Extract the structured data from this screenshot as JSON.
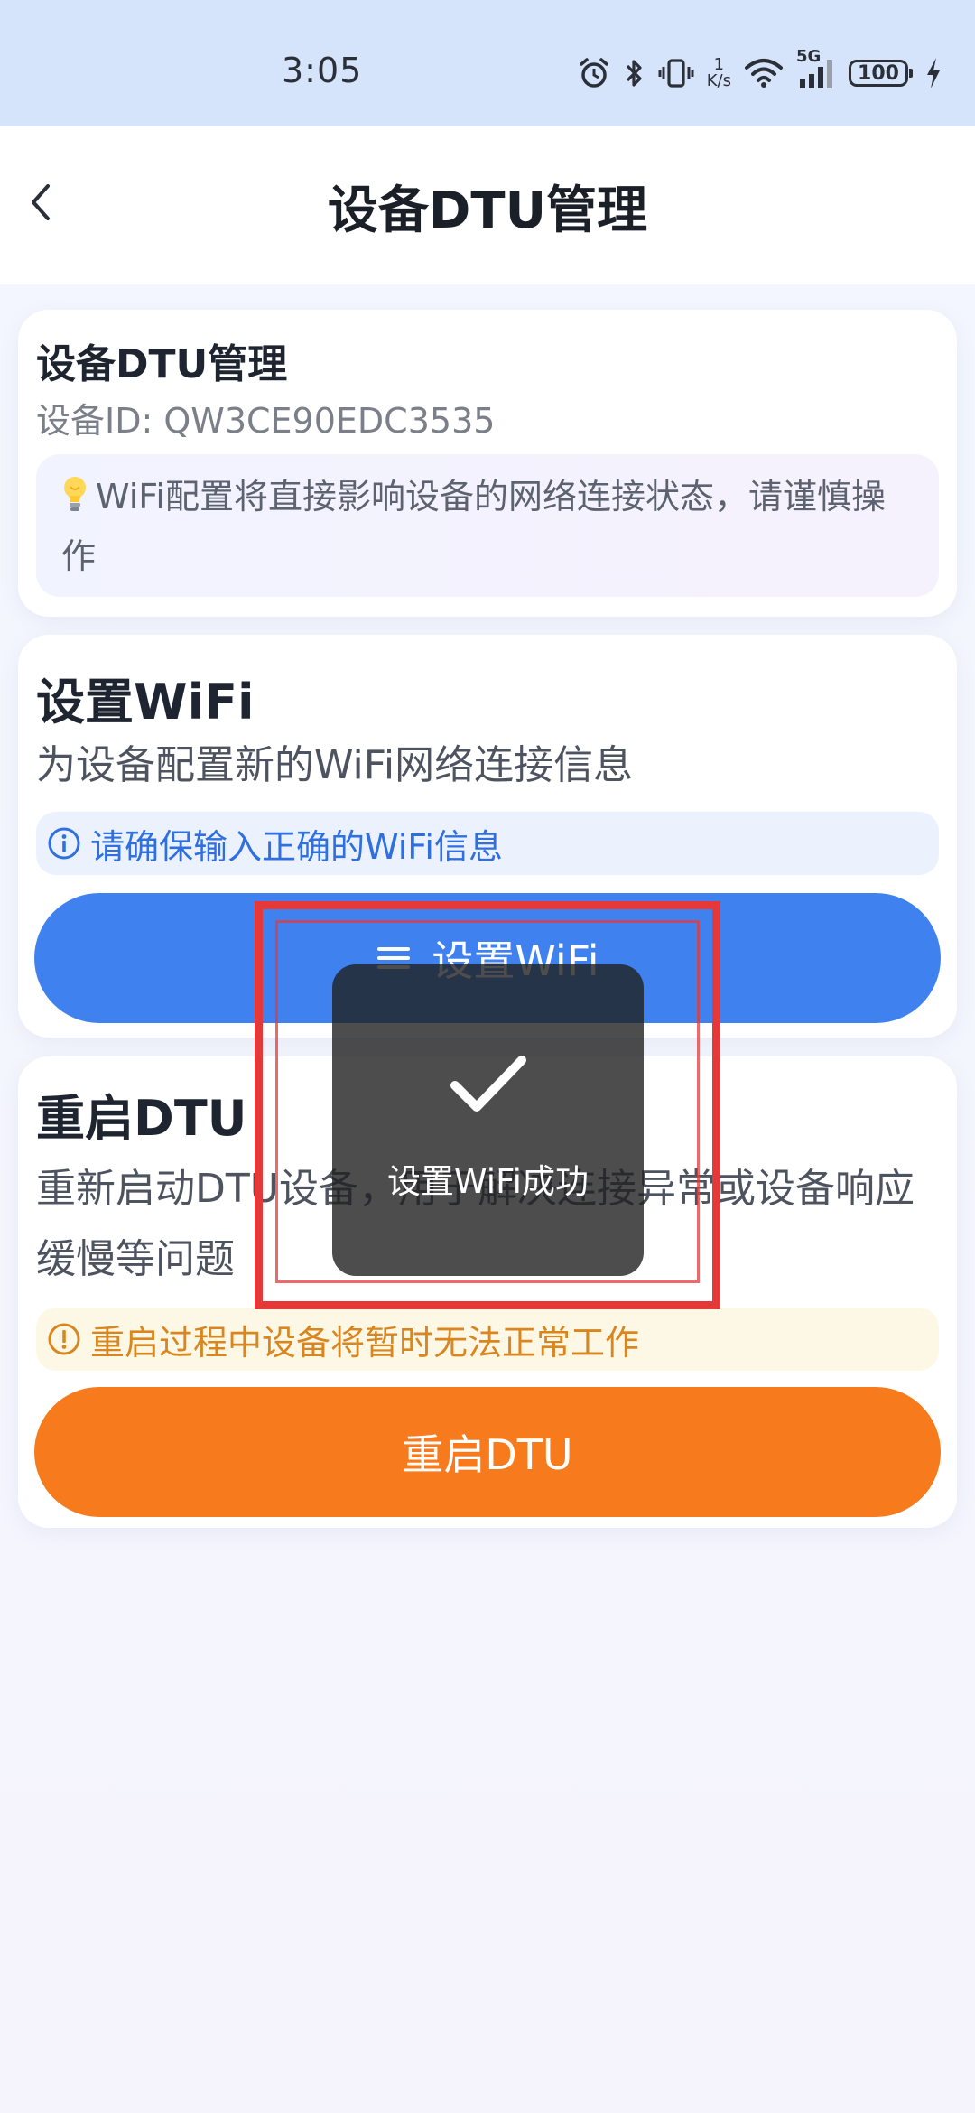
{
  "status_bar": {
    "time": "3:05",
    "net_speed_value": "1",
    "net_speed_unit": "K/s",
    "network_type": "5G",
    "battery": "100",
    "icons": [
      "alarm-icon",
      "bluetooth-icon",
      "vibrate-icon",
      "wifi-icon",
      "signal-icon",
      "battery-icon",
      "charging-icon"
    ]
  },
  "header": {
    "title": "设备DTU管理",
    "back_icon": "chevron-left-icon"
  },
  "info_card": {
    "title": "设备DTU管理",
    "device_id": "设备ID: QW3CE90EDC3535",
    "notice_icon": "lightbulb-icon",
    "notice": "WiFi配置将直接影响设备的网络连接状态，请谨慎操作"
  },
  "wifi_card": {
    "title": "设置WiFi",
    "description": "为设备配置新的WiFi网络连接信息",
    "hint_icon": "info-circle-icon",
    "hint": "请确保输入正确的WiFi信息",
    "button_icon": "menu-icon",
    "button_label": "设置WiFi"
  },
  "restart_card": {
    "title": "重启DTU",
    "description": "重新启动DTU设备，用于解决连接异常或设备响应缓慢等问题",
    "hint_icon": "warning-circle-icon",
    "hint": "重启过程中设备将暂时无法正常工作",
    "button_label": "重启DTU"
  },
  "toast": {
    "icon": "checkmark-icon",
    "message": "设置WiFi成功"
  },
  "colors": {
    "status_bar_bg": "#d6e4fb",
    "primary_blue": "#3f82ef",
    "info_text_blue": "#2f6fe0",
    "restart_orange": "#f77a1c",
    "warning_text": "#d9861e",
    "highlight_red": "#e53838"
  }
}
